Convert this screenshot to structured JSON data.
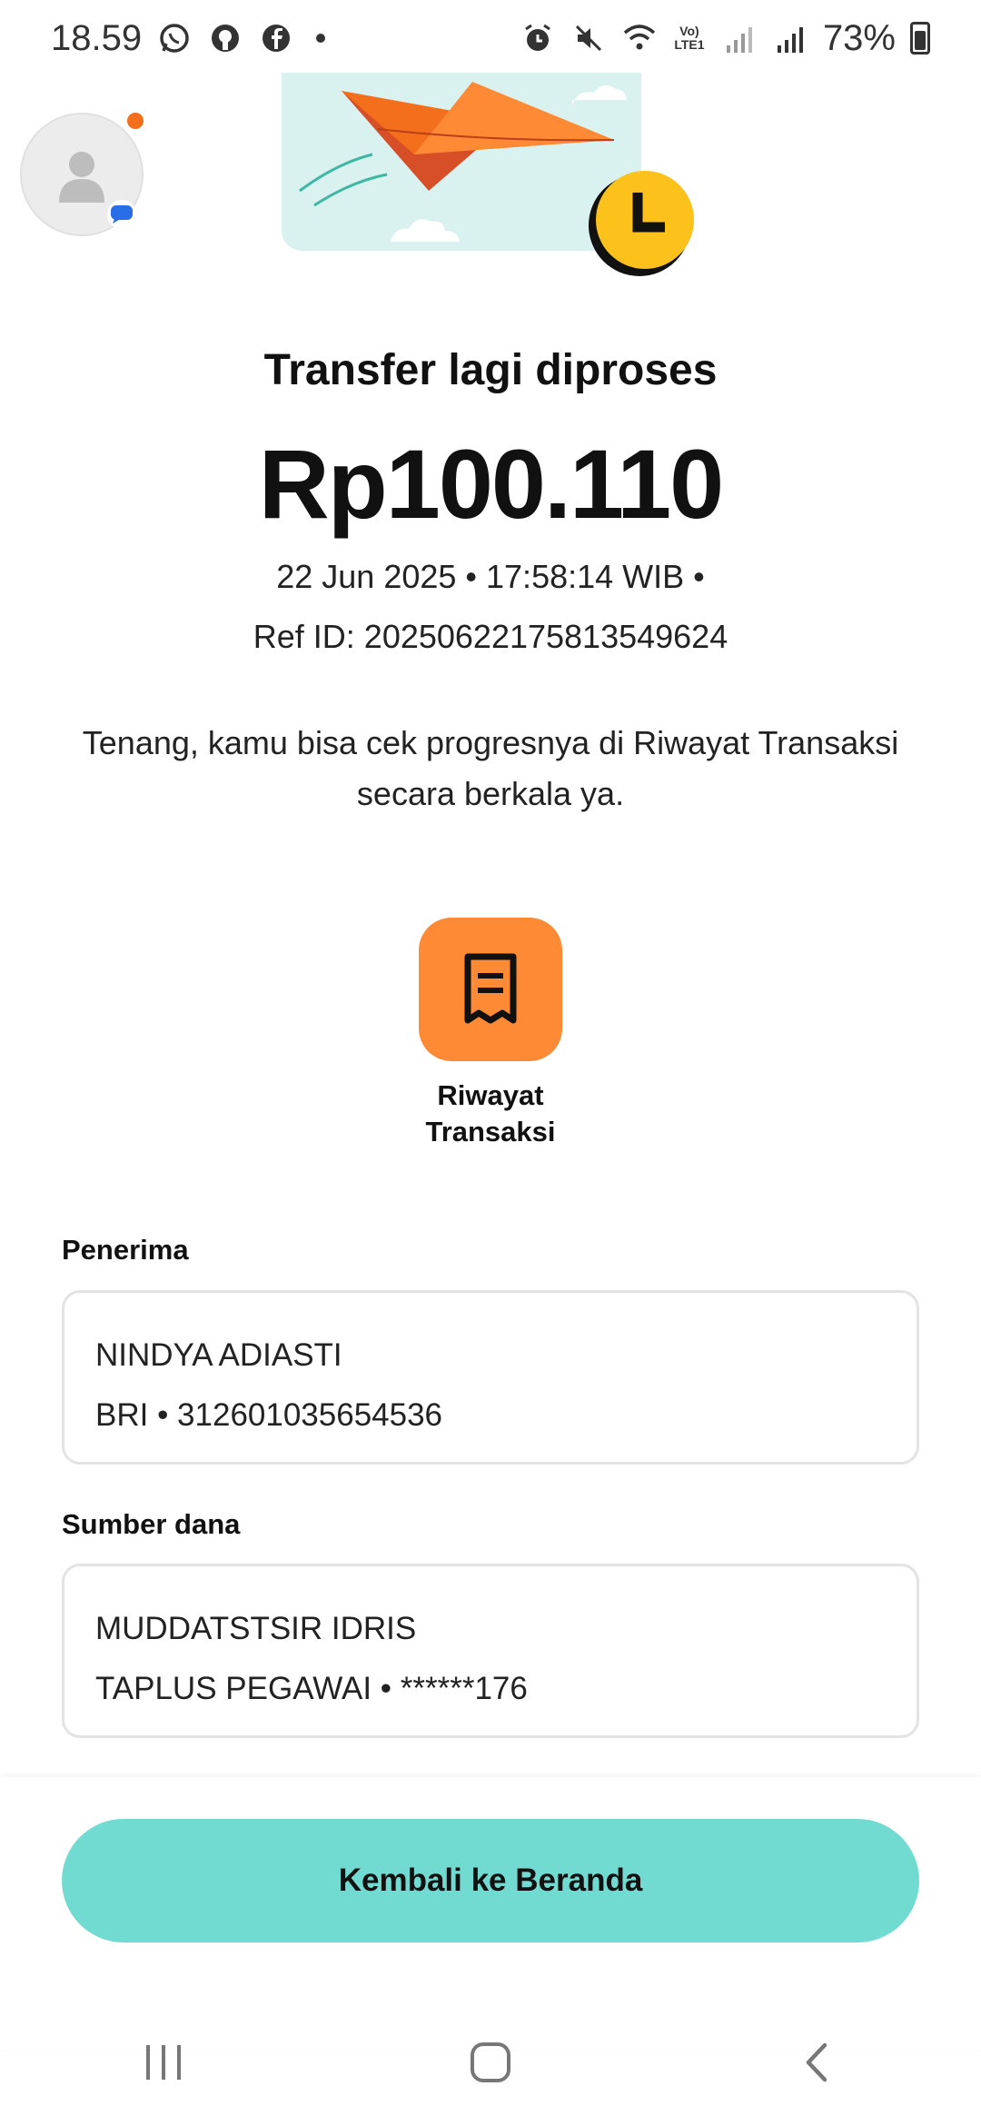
{
  "status_bar": {
    "time": "18.59",
    "battery": "73%",
    "network_label": "Vo) LTE1"
  },
  "hero": {
    "title": "Transfer lagi diproses",
    "amount": "Rp100.110",
    "datetime": "22 Jun 2025 • 17:58:14 WIB •",
    "ref": "Ref ID: 20250622175813549624"
  },
  "info_text": "Tenang, kamu bisa cek progresnya di Riwayat Transaksi secara berkala ya.",
  "shortcut": {
    "label": "Riwayat Transaksi",
    "icon": "receipt-icon",
    "color": "#ff8a35"
  },
  "recipient": {
    "label": "Penerima",
    "name": "NINDYA ADIASTI",
    "account": "BRI • 312601035654536"
  },
  "source": {
    "label": "Sumber dana",
    "name": "MUDDATSTSIR IDRIS",
    "account": "TAPLUS PEGAWAI • ******176"
  },
  "primary_action": {
    "label": "Kembali ke Beranda",
    "color": "#72dbd1"
  },
  "colors": {
    "accent_orange": "#ff8a35",
    "accent_teal": "#72dbd1",
    "clock_yellow": "#fcc21b"
  }
}
